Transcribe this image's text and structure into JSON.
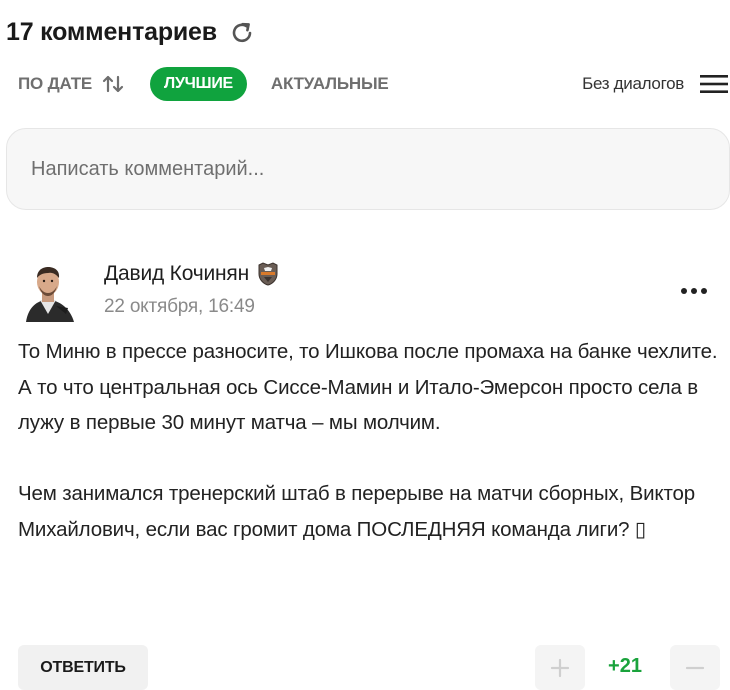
{
  "comments": {
    "title": "17 комментариев",
    "sort": {
      "by_date": "ПО ДАТЕ",
      "best": "ЛУЧШИЕ",
      "actual": "АКТУАЛЬНЫЕ"
    },
    "no_dialogs": "Без диалогов",
    "input_placeholder": "Написать комментарий...",
    "accent_color": "#10a33e"
  },
  "comment": {
    "author": "Давид Кочинян",
    "date": "22 октября, 16:49",
    "paragraph1": "То Миню в прессе разносите, то Ишкова после промаха на банке чехлите. А то что центральная ось Сиссе-Мамин и Итало-Эмерсон просто села в лужу в первые 30 минут матча – мы молчим.",
    "paragraph2": "Чем занимался тренерский штаб в перерыве на матчи сборных, Виктор Михайлович, если вас громит дома ПОСЛЕДНЯЯ команда лиги? ",
    "emoji_placeholder": "▯",
    "reply_label": "ОТВЕТИТЬ",
    "score": "+21",
    "icons": {
      "refresh": "refresh-icon",
      "sort": "sort-arrows-icon",
      "menu": "hamburger-menu-icon",
      "badge": "club-badge-icon",
      "more": "more-dots-icon",
      "plus": "plus-icon",
      "minus": "minus-icon"
    }
  }
}
